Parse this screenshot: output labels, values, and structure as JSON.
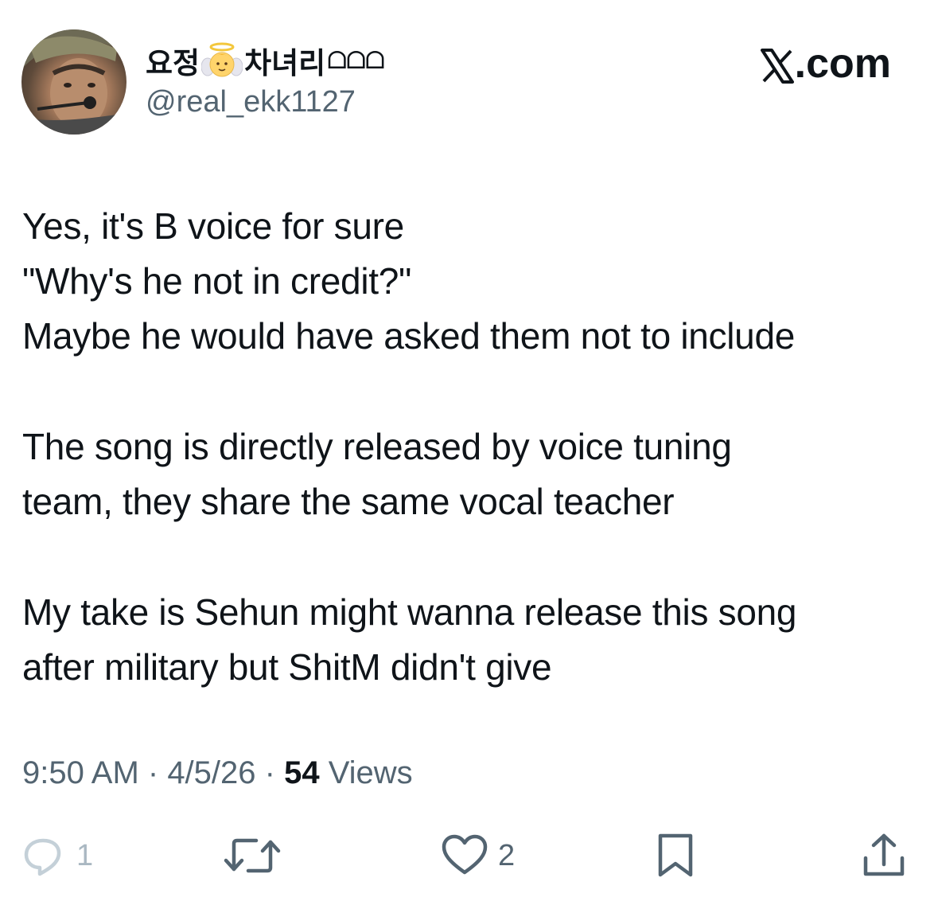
{
  "author": {
    "display_name_prefix": "요정",
    "display_name_suffix": "차녀리",
    "display_name_trailing": "ᗝᗝᗝ",
    "handle": "@real_ekk1127",
    "avatar_icon": "profile-photo",
    "badge_icon": "angel-emoji"
  },
  "brand": {
    "x_icon": "x-logo-icon",
    "domain_text": ".com"
  },
  "tweet": {
    "lines": [
      "Yes, it's B voice for sure",
      "\"Why's he not in credit?\"",
      "Maybe he would have asked them not to include",
      "The song is directly released by voice tuning",
      "team, they share the same vocal teacher",
      "My take is Sehun might wanna release this song",
      "after military but ShitM didn't give"
    ]
  },
  "meta": {
    "time": "9:50 AM",
    "separator": " · ",
    "date": "4/5/26",
    "views_count": "54",
    "views_label": " Views"
  },
  "actions": {
    "reply_count": "1",
    "like_count": "2"
  },
  "colors": {
    "text": "#0f1419",
    "secondary": "#536471",
    "background": "#ffffff"
  }
}
